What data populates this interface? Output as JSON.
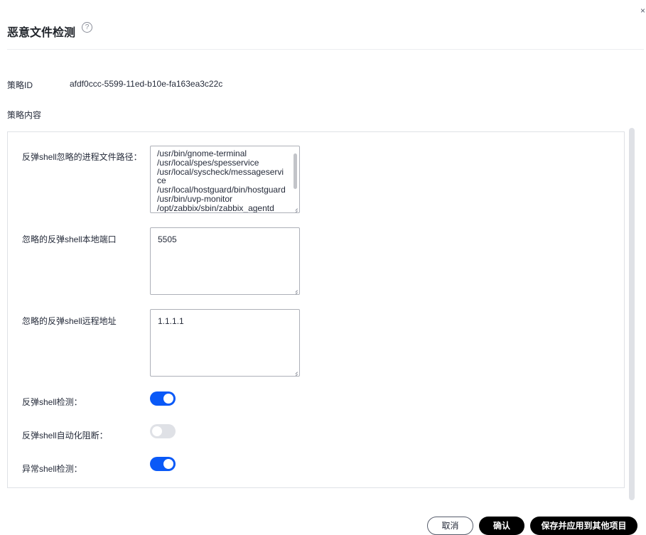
{
  "header": {
    "title": "恶意文件检测",
    "help_icon": "question-circle-icon",
    "close_icon": "×"
  },
  "policy": {
    "id_label": "策略ID",
    "id_value": "afdf0ccc-5599-11ed-b10e-fa163ea3c22c",
    "content_label": "策略内容"
  },
  "fields": {
    "ignore_paths": {
      "label": "反弹shell忽略的进程文件路径：",
      "lines": [
        "/usr/bin/gnome-terminal",
        "/usr/local/spes/spesservice",
        "/usr/local/syscheck/messageservi",
        "ce",
        "/usr/local/hostguard/bin/hostguard",
        "/usr/bin/uvp-monitor",
        "/opt/zabbix/sbin/zabbix_agentd"
      ]
    },
    "ignore_ports": {
      "label": "忽略的反弹shell本地端口",
      "value": "5505"
    },
    "ignore_remote": {
      "label": "忽略的反弹shell远程地址",
      "value": "1.1.1.1"
    }
  },
  "toggles": [
    {
      "label": "反弹shell检测：",
      "state": "on"
    },
    {
      "label": "反弹shell自动化阻断：",
      "state": "off"
    },
    {
      "label": "异常shell检测：",
      "state": "on"
    }
  ],
  "footer": {
    "cancel_label": "取消",
    "confirm_label": "确认",
    "save_apply_label": "保存并应用到其他项目"
  },
  "colors": {
    "accent": "#0a59f7",
    "toggle_off": "#dfe1e6",
    "primary_button": "#000000"
  }
}
